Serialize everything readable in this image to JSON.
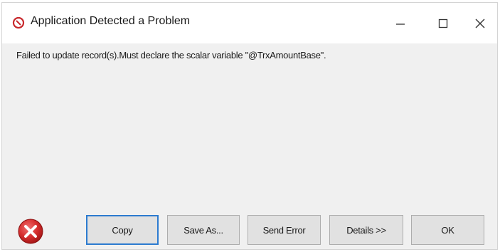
{
  "window": {
    "title": "Application Detected a Problem",
    "title_icon": "error-circle-small-icon",
    "controls": {
      "minimize_icon": "minimize-icon",
      "maximize_icon": "maximize-icon",
      "close_icon": "close-icon"
    }
  },
  "dialog": {
    "message": "Failed to update record(s).Must declare the scalar variable \"@TrxAmountBase\".",
    "error_icon": "error-icon"
  },
  "buttons": {
    "copy": "Copy",
    "save_as": "Save As...",
    "send_error": "Send Error",
    "details": "Details >>",
    "ok": "OK"
  },
  "colors": {
    "error_red": "#d62e2e",
    "default_button_border": "#2c7bd0",
    "dialog_background": "#f0f0f0"
  }
}
